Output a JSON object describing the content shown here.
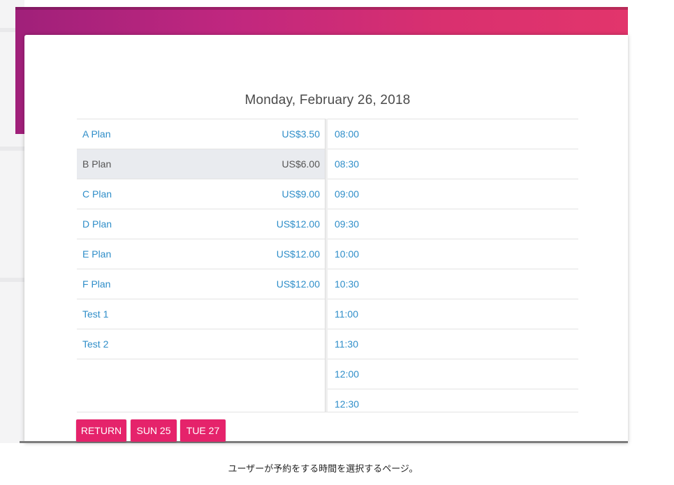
{
  "date_title": "Monday, February 26, 2018",
  "plans": [
    {
      "name": "A Plan",
      "price": "US$3.50",
      "selected": false
    },
    {
      "name": "B Plan",
      "price": "US$6.00",
      "selected": true
    },
    {
      "name": "C Plan",
      "price": "US$9.00",
      "selected": false
    },
    {
      "name": "D Plan",
      "price": "US$12.00",
      "selected": false
    },
    {
      "name": "E Plan",
      "price": "US$12.00",
      "selected": false
    },
    {
      "name": "F Plan",
      "price": "US$12.00",
      "selected": false
    },
    {
      "name": "Test 1",
      "price": "",
      "selected": false
    },
    {
      "name": "Test 2",
      "price": "",
      "selected": false
    }
  ],
  "times": [
    "08:00",
    "08:30",
    "09:00",
    "09:30",
    "10:00",
    "10:30",
    "11:00",
    "11:30",
    "12:00",
    "12:30"
  ],
  "buttons": {
    "return": "RETURN",
    "prev_day": "SUN 25",
    "next_day": "TUE 27"
  },
  "caption": "ユーザーが予約をする時間を選択するページ。",
  "colors": {
    "accent": "#e5236b",
    "link": "#2f8ec9",
    "header_start": "#a0207a",
    "header_end": "#e2356c",
    "selected_row": "#e9ebef"
  }
}
